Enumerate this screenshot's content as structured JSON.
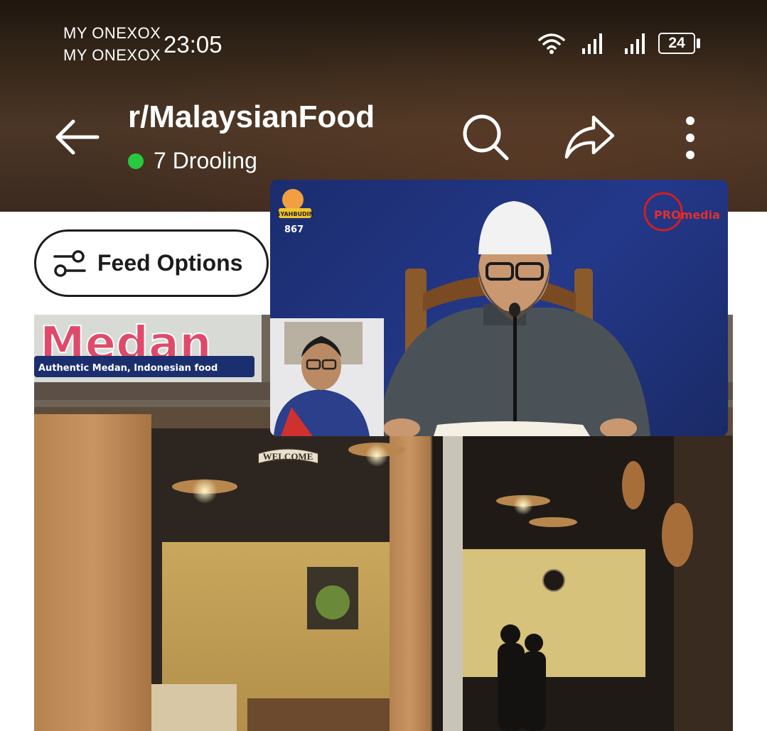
{
  "status_bar": {
    "carrier_1": "MY ONEXOX",
    "carrier_2": "MY ONEXOX",
    "time": "23:05",
    "battery": "24",
    "icons": [
      "wifi-icon",
      "signal-icon",
      "signal-icon",
      "battery-icon"
    ]
  },
  "header": {
    "subreddit": "r/MalaysianFood",
    "online_count": "7 Drooling",
    "online_color": "#27c93f",
    "icons": [
      "back-arrow-icon",
      "search-icon",
      "share-icon",
      "more-vertical-icon"
    ]
  },
  "feed_options": {
    "label": "Feed Options",
    "icon": "sliders-icon"
  },
  "post_image": {
    "sign_main": "Medan",
    "sign_sub": "Authentic Medan, Indonesian food",
    "welcome_sign": "WELCOME"
  },
  "video_overlay": {
    "channel_logo_text": "SYAHBUDIN",
    "viewer_count": "867",
    "brand_logo_text": "PROmedia"
  }
}
